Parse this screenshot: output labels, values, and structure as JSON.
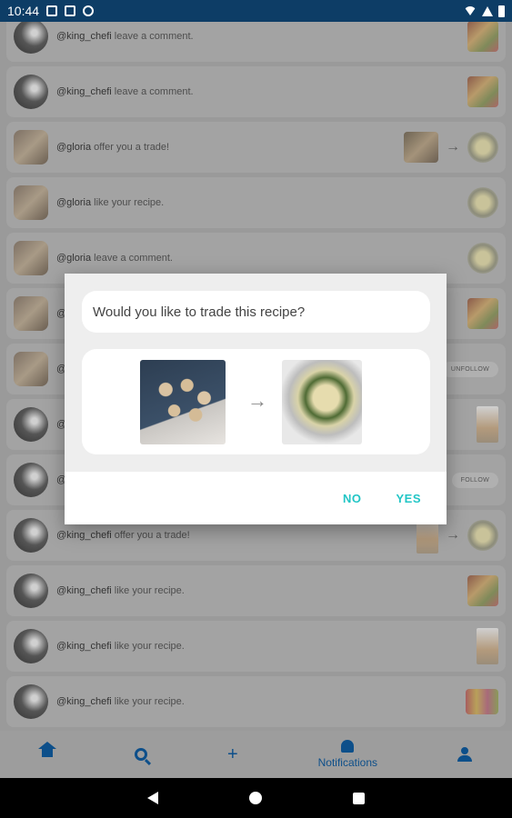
{
  "status_bar": {
    "time": "10:44"
  },
  "notifications": [
    {
      "user": "@king_chefi",
      "action": "leave a comment."
    },
    {
      "user": "@king_chefi",
      "action": "leave a comment."
    },
    {
      "user": "@gloria",
      "action": "offer you a trade!"
    },
    {
      "user": "@gloria",
      "action": "like your recipe."
    },
    {
      "user": "@gloria",
      "action": "leave a comment."
    },
    {
      "user": "@",
      "action": ""
    },
    {
      "user": "@",
      "action": "",
      "button": "UNFOLLOW"
    },
    {
      "user": "@",
      "action": ""
    },
    {
      "user": "@",
      "action": "",
      "button": "FOLLOW"
    },
    {
      "user": "@king_chefi",
      "action": "offer you a trade!"
    },
    {
      "user": "@king_chefi",
      "action": "like your recipe."
    },
    {
      "user": "@king_chefi",
      "action": "like your recipe."
    },
    {
      "user": "@king_chefi",
      "action": "like your recipe."
    }
  ],
  "bottom_nav": {
    "notifications_label": "Notifications"
  },
  "dialog": {
    "question": "Would you like to trade this recipe?",
    "trade_arrow": "→",
    "no_label": "NO",
    "yes_label": "YES"
  },
  "colors": {
    "accent": "#22c6c6",
    "nav": "#0d4f8a",
    "status_bar": "#0d3d66"
  }
}
